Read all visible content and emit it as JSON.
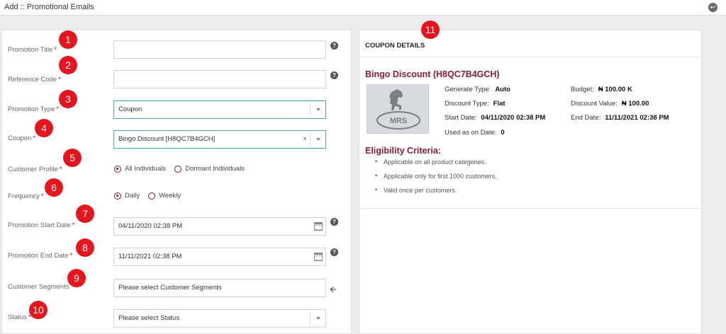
{
  "topbar": {
    "title": "Add :: Promotional Emails"
  },
  "form": {
    "promotion_title": {
      "label": "Promotion Title",
      "value": "",
      "badge": "1"
    },
    "reference_code": {
      "label": "Reference Code",
      "value": "",
      "badge": "2"
    },
    "promotion_type": {
      "label": "Promotion Type",
      "value": "Coupon",
      "badge": "3"
    },
    "coupon": {
      "label": "Coupon",
      "value": "Bingo Discount [H8QC7B4GCH]",
      "badge": "4"
    },
    "customer_profile": {
      "label": "Customer Profile",
      "options": [
        "All Individuals",
        "Dormant Individuals"
      ],
      "selected": "All Individuals",
      "badge": "5"
    },
    "frequency": {
      "label": "Frequency",
      "options": [
        "Daily",
        "Weekly"
      ],
      "selected": "Daily",
      "badge": "6"
    },
    "start_date": {
      "label": "Promotion Start Date",
      "value": "04/11/2020  02:38 PM",
      "badge": "7"
    },
    "end_date": {
      "label": "Promotion End Date",
      "value": "11/11/2021  02:38 PM",
      "badge": "8"
    },
    "customer_segments": {
      "label": "Customer Segments",
      "placeholder": "Please select Customer Segments",
      "badge": "9"
    },
    "status": {
      "label": "Status",
      "placeholder": "Please select Status",
      "badge": "10"
    },
    "required_mark": "*"
  },
  "coupon_details": {
    "badge": "11",
    "header": "COUPON DETAILS",
    "name": "Bingo Discount (H8QC7B4GCH)",
    "logo_text": "MRS",
    "generate_type": {
      "label": "Generate Type:",
      "value": "Auto"
    },
    "discount_type": {
      "label": "Discount Type:",
      "value": "Flat"
    },
    "start_date": {
      "label": "Start Date:",
      "value": "04/11/2020 02:38 PM"
    },
    "used_as_on_date": {
      "label": "Used as on Date:",
      "value": "0"
    },
    "budget": {
      "label": "Budget:",
      "value": "₦ 100.00 K"
    },
    "discount_value": {
      "label": "Discount Value:",
      "value": "₦ 100.00"
    },
    "end_date": {
      "label": "End Date:",
      "value": "11/11/2021 02:38 PM"
    },
    "eligibility_title": "Eligibility Criteria:",
    "eligibility": [
      "Applicable on all product categories.",
      "Applicable only for first 1000 customers.",
      "Valid once per customers."
    ]
  },
  "colors": {
    "accent": "#8a1c34",
    "badge": "#e6141c",
    "teal_border": "#4aa7a0"
  },
  "icons": {
    "back": "back-circle-icon",
    "help": "question-circle-icon",
    "calendar": "calendar-icon",
    "arrow": "arrow-left-icon"
  }
}
